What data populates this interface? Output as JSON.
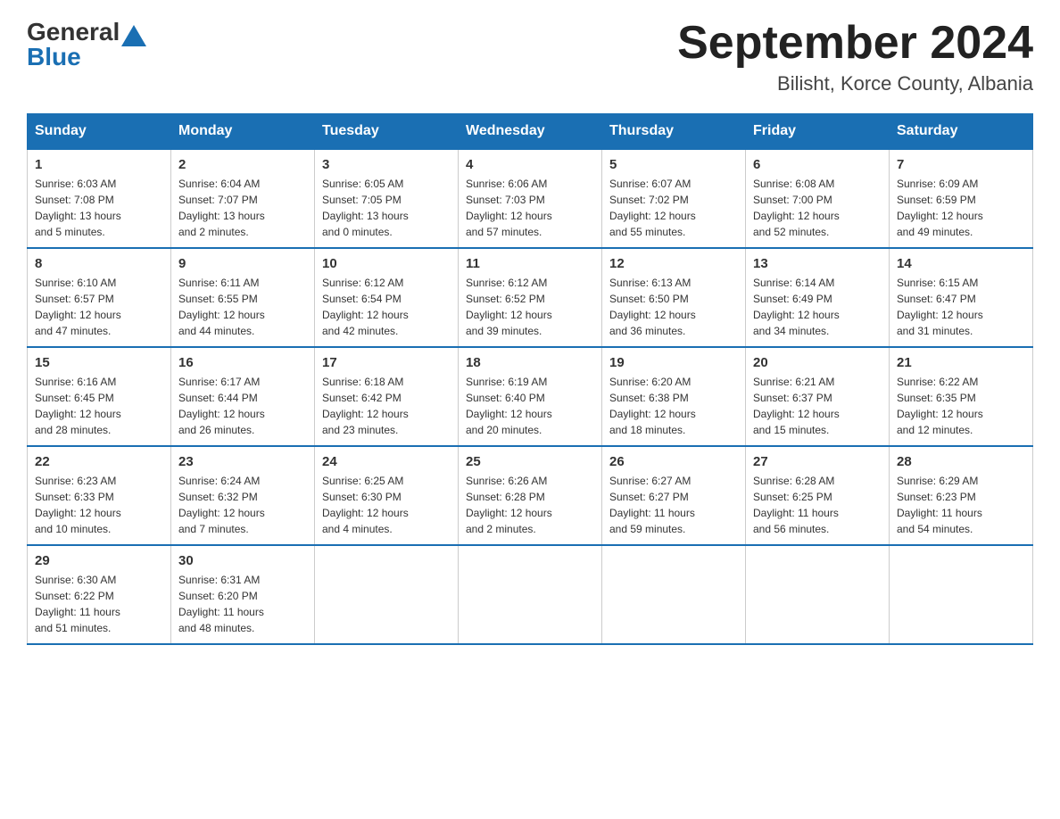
{
  "header": {
    "logo_general": "General",
    "logo_blue": "Blue",
    "title": "September 2024",
    "subtitle": "Bilisht, Korce County, Albania"
  },
  "days_of_week": [
    "Sunday",
    "Monday",
    "Tuesday",
    "Wednesday",
    "Thursday",
    "Friday",
    "Saturday"
  ],
  "weeks": [
    [
      {
        "day": "1",
        "sunrise": "6:03 AM",
        "sunset": "7:08 PM",
        "daylight": "13 hours and 5 minutes."
      },
      {
        "day": "2",
        "sunrise": "6:04 AM",
        "sunset": "7:07 PM",
        "daylight": "13 hours and 2 minutes."
      },
      {
        "day": "3",
        "sunrise": "6:05 AM",
        "sunset": "7:05 PM",
        "daylight": "13 hours and 0 minutes."
      },
      {
        "day": "4",
        "sunrise": "6:06 AM",
        "sunset": "7:03 PM",
        "daylight": "12 hours and 57 minutes."
      },
      {
        "day": "5",
        "sunrise": "6:07 AM",
        "sunset": "7:02 PM",
        "daylight": "12 hours and 55 minutes."
      },
      {
        "day": "6",
        "sunrise": "6:08 AM",
        "sunset": "7:00 PM",
        "daylight": "12 hours and 52 minutes."
      },
      {
        "day": "7",
        "sunrise": "6:09 AM",
        "sunset": "6:59 PM",
        "daylight": "12 hours and 49 minutes."
      }
    ],
    [
      {
        "day": "8",
        "sunrise": "6:10 AM",
        "sunset": "6:57 PM",
        "daylight": "12 hours and 47 minutes."
      },
      {
        "day": "9",
        "sunrise": "6:11 AM",
        "sunset": "6:55 PM",
        "daylight": "12 hours and 44 minutes."
      },
      {
        "day": "10",
        "sunrise": "6:12 AM",
        "sunset": "6:54 PM",
        "daylight": "12 hours and 42 minutes."
      },
      {
        "day": "11",
        "sunrise": "6:12 AM",
        "sunset": "6:52 PM",
        "daylight": "12 hours and 39 minutes."
      },
      {
        "day": "12",
        "sunrise": "6:13 AM",
        "sunset": "6:50 PM",
        "daylight": "12 hours and 36 minutes."
      },
      {
        "day": "13",
        "sunrise": "6:14 AM",
        "sunset": "6:49 PM",
        "daylight": "12 hours and 34 minutes."
      },
      {
        "day": "14",
        "sunrise": "6:15 AM",
        "sunset": "6:47 PM",
        "daylight": "12 hours and 31 minutes."
      }
    ],
    [
      {
        "day": "15",
        "sunrise": "6:16 AM",
        "sunset": "6:45 PM",
        "daylight": "12 hours and 28 minutes."
      },
      {
        "day": "16",
        "sunrise": "6:17 AM",
        "sunset": "6:44 PM",
        "daylight": "12 hours and 26 minutes."
      },
      {
        "day": "17",
        "sunrise": "6:18 AM",
        "sunset": "6:42 PM",
        "daylight": "12 hours and 23 minutes."
      },
      {
        "day": "18",
        "sunrise": "6:19 AM",
        "sunset": "6:40 PM",
        "daylight": "12 hours and 20 minutes."
      },
      {
        "day": "19",
        "sunrise": "6:20 AM",
        "sunset": "6:38 PM",
        "daylight": "12 hours and 18 minutes."
      },
      {
        "day": "20",
        "sunrise": "6:21 AM",
        "sunset": "6:37 PM",
        "daylight": "12 hours and 15 minutes."
      },
      {
        "day": "21",
        "sunrise": "6:22 AM",
        "sunset": "6:35 PM",
        "daylight": "12 hours and 12 minutes."
      }
    ],
    [
      {
        "day": "22",
        "sunrise": "6:23 AM",
        "sunset": "6:33 PM",
        "daylight": "12 hours and 10 minutes."
      },
      {
        "day": "23",
        "sunrise": "6:24 AM",
        "sunset": "6:32 PM",
        "daylight": "12 hours and 7 minutes."
      },
      {
        "day": "24",
        "sunrise": "6:25 AM",
        "sunset": "6:30 PM",
        "daylight": "12 hours and 4 minutes."
      },
      {
        "day": "25",
        "sunrise": "6:26 AM",
        "sunset": "6:28 PM",
        "daylight": "12 hours and 2 minutes."
      },
      {
        "day": "26",
        "sunrise": "6:27 AM",
        "sunset": "6:27 PM",
        "daylight": "11 hours and 59 minutes."
      },
      {
        "day": "27",
        "sunrise": "6:28 AM",
        "sunset": "6:25 PM",
        "daylight": "11 hours and 56 minutes."
      },
      {
        "day": "28",
        "sunrise": "6:29 AM",
        "sunset": "6:23 PM",
        "daylight": "11 hours and 54 minutes."
      }
    ],
    [
      {
        "day": "29",
        "sunrise": "6:30 AM",
        "sunset": "6:22 PM",
        "daylight": "11 hours and 51 minutes."
      },
      {
        "day": "30",
        "sunrise": "6:31 AM",
        "sunset": "6:20 PM",
        "daylight": "11 hours and 48 minutes."
      },
      null,
      null,
      null,
      null,
      null
    ]
  ],
  "labels": {
    "sunrise": "Sunrise:",
    "sunset": "Sunset:",
    "daylight": "Daylight:"
  }
}
